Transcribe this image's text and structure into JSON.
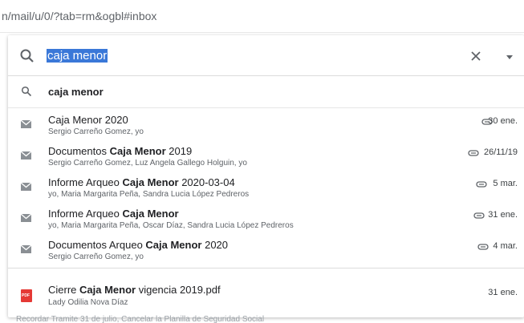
{
  "address_bar": {
    "url": "n/mail/u/0/?tab=rm&ogbl#inbox"
  },
  "search": {
    "query": "caja menor"
  },
  "suggestion": {
    "text": "caja menor"
  },
  "results": [
    {
      "title_pre": "Caja Menor 2020",
      "title_bold": "",
      "title_post": "",
      "participants": "Sergio Carreño Gomez, yo",
      "date": "30 ene."
    },
    {
      "title_pre": "Documentos ",
      "title_bold": "Caja Menor",
      "title_post": " 2019",
      "participants": "Sergio Carreño Gomez, Luz Angela Gallego Holguin, yo",
      "date": "26/11/19"
    },
    {
      "title_pre": "Informe Arqueo ",
      "title_bold": "Caja Menor",
      "title_post": " 2020-03-04",
      "participants": "yo, Maria Margarita Peña, Sandra Lucia López Pedreros",
      "date": "5 mar."
    },
    {
      "title_pre": "Informe Arqueo ",
      "title_bold": "Caja Menor",
      "title_post": "",
      "participants": "yo, Maria Margarita Peña, Oscar Díaz, Sandra Lucia López Pedreros",
      "date": "31 ene."
    },
    {
      "title_pre": "Documentos Arqueo ",
      "title_bold": "Caja Menor",
      "title_post": " 2020",
      "participants": "Sergio Carreño Gomez, yo",
      "date": "4 mar."
    }
  ],
  "file": {
    "title_pre": "Cierre ",
    "title_bold": "Caja Menor",
    "title_post": " vigencia 2019.pdf",
    "owner": "Lady Odilia Nova Díaz",
    "date": "31 ene.",
    "badge": "PDF"
  },
  "background_peek": "Recordar Tramite 31 de julio, Cancelar la Planilla de Seguridad Social"
}
